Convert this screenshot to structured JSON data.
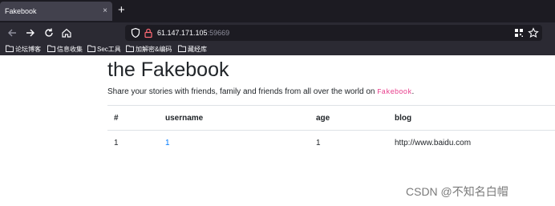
{
  "browser": {
    "tab_title": "Fakebook",
    "tab_close": "×",
    "new_tab": "+",
    "url_host": "61.147.171.105",
    "url_port": ":59669",
    "bookmarks": [
      "论坛博客",
      "信息收集",
      "Sec工具",
      "加解密&编码",
      "藏经库"
    ]
  },
  "page": {
    "title": "the Fakebook",
    "lead_text": "Share your stories with friends, family and friends from all over the world on ",
    "lead_brand": "Fakebook",
    "lead_end": "."
  },
  "table": {
    "headers": [
      "#",
      "username",
      "age",
      "blog"
    ],
    "rows": [
      {
        "no": "1",
        "username": "1",
        "age": "1",
        "blog": "http://www.baidu.com"
      }
    ]
  },
  "watermark": "CSDN @不知名白帽"
}
